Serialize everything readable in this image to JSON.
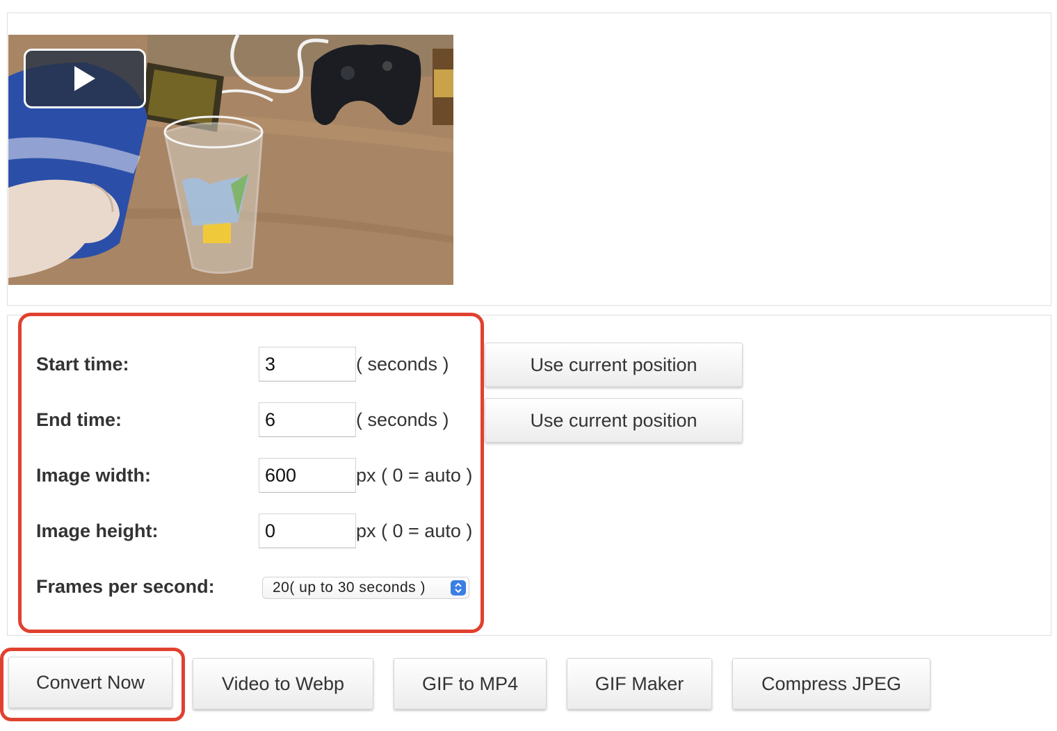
{
  "video": {
    "play_icon": "play-icon"
  },
  "settings": {
    "start_time": {
      "label": "Start time:",
      "value": "3",
      "unit": "( seconds )",
      "button": "Use current position"
    },
    "end_time": {
      "label": "End time:",
      "value": "6",
      "unit": "( seconds )",
      "button": "Use current position"
    },
    "image_width": {
      "label": "Image width:",
      "value": "600",
      "unit": "px ( 0 = auto )"
    },
    "image_height": {
      "label": "Image height:",
      "value": "0",
      "unit": "px ( 0 = auto )"
    },
    "fps": {
      "label": "Frames per second:",
      "selected": "20( up to 30 seconds )"
    }
  },
  "buttons": {
    "convert_now": "Convert Now",
    "video_to_webp": "Video to Webp",
    "gif_to_mp4": "GIF to MP4",
    "gif_maker": "GIF Maker",
    "compress_jpeg": "Compress JPEG"
  },
  "colors": {
    "highlight": "#e0412f",
    "select_accent": "#3a7ee6"
  }
}
